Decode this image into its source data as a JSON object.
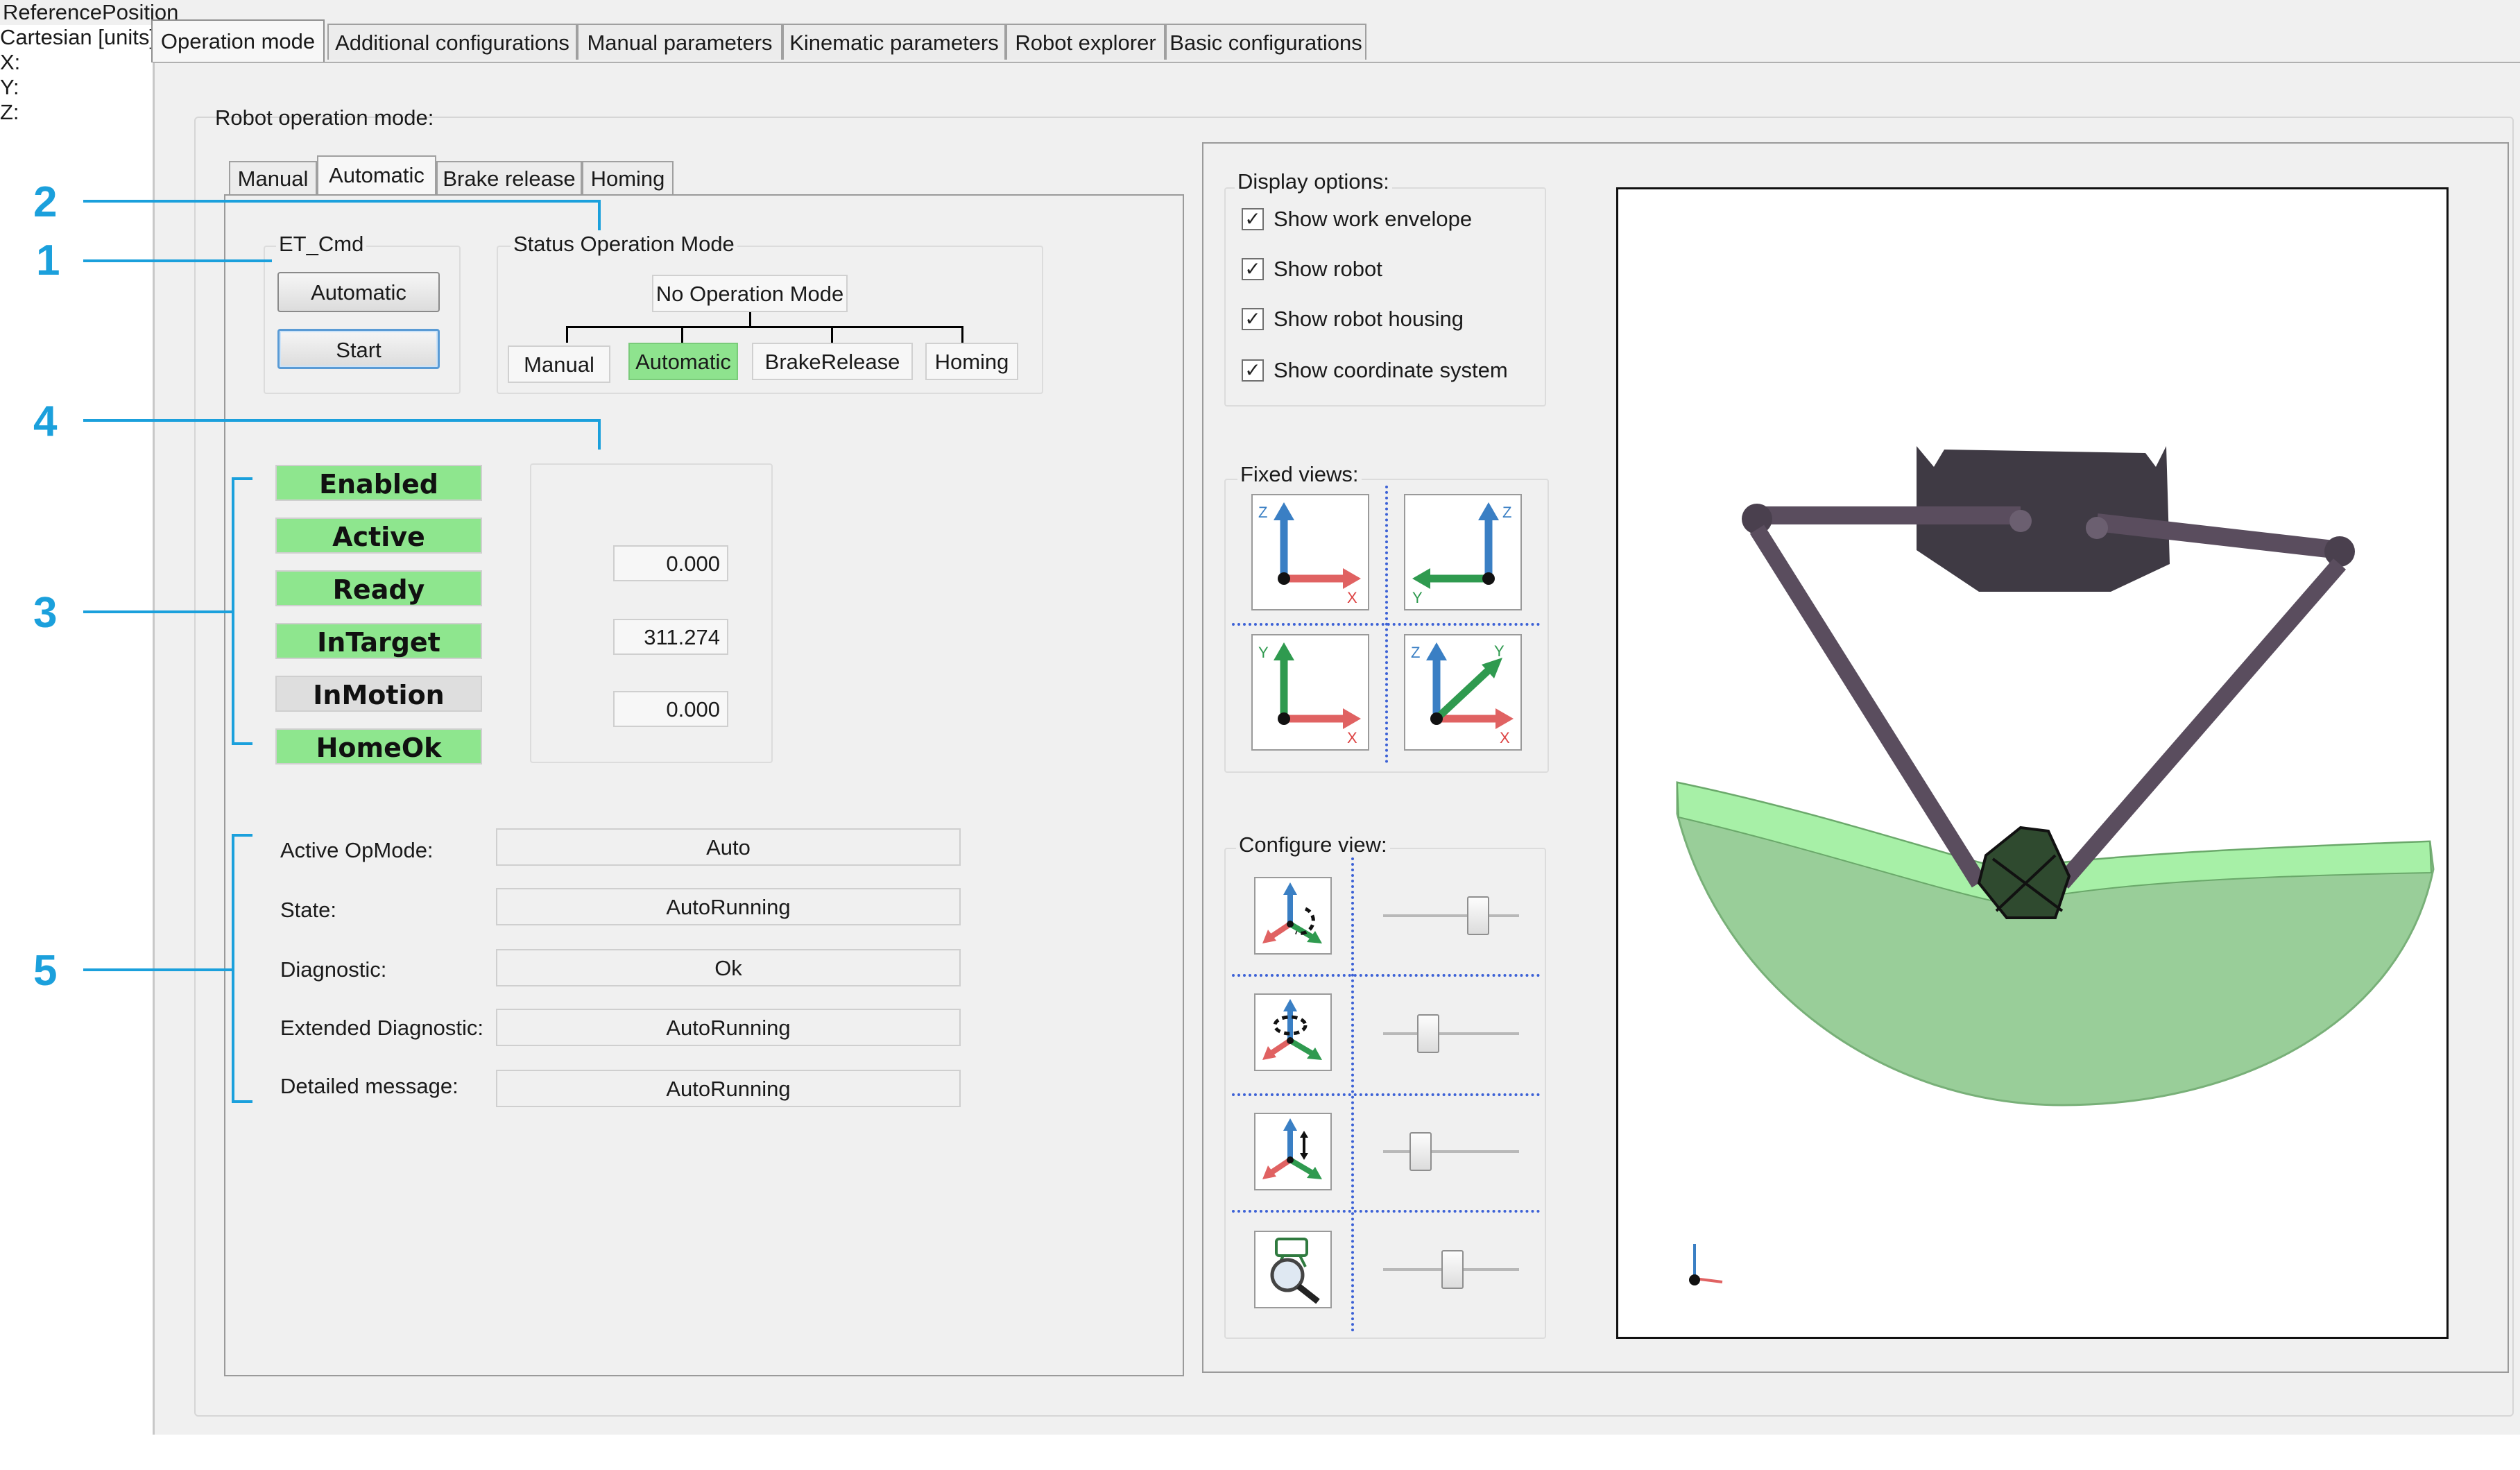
{
  "main_tabs": [
    {
      "label": "Operation mode"
    },
    {
      "label": "Additional configurations"
    },
    {
      "label": "Manual parameters"
    },
    {
      "label": "Kinematic parameters"
    },
    {
      "label": "Robot explorer"
    },
    {
      "label": "Basic configurations"
    }
  ],
  "robot_operation_mode_label": "Robot operation mode:",
  "sub_tabs": [
    {
      "label": "Manual"
    },
    {
      "label": "Automatic"
    },
    {
      "label": "Brake release"
    },
    {
      "label": "Homing"
    }
  ],
  "et_cmd": {
    "title": "ET_Cmd",
    "mode_button": "Automatic",
    "start_button": "Start"
  },
  "status_operation_mode": {
    "title": "Status Operation Mode",
    "root": "No Operation Mode",
    "children": [
      {
        "label": "Manual",
        "active": false
      },
      {
        "label": "Automatic",
        "active": true
      },
      {
        "label": "BrakeRelease",
        "active": false
      },
      {
        "label": "Homing",
        "active": false
      }
    ],
    "active_color": "#8ee38e"
  },
  "indicators": [
    {
      "label": "Enabled",
      "on": true
    },
    {
      "label": "Active",
      "on": true
    },
    {
      "label": "Ready",
      "on": true
    },
    {
      "label": "InTarget",
      "on": true
    },
    {
      "label": "InMotion",
      "on": false
    },
    {
      "label": "HomeOk",
      "on": true
    }
  ],
  "reference_position": {
    "title_line1": "ReferencePosition",
    "title_line2": "Cartesian [units]:",
    "x_label": "X:",
    "x_value": "0.000",
    "y_label": "Y:",
    "y_value": "311.274",
    "z_label": "Z:",
    "z_value": "0.000"
  },
  "info_fields": [
    {
      "label": "Active OpMode:",
      "value": "Auto"
    },
    {
      "label": "State:",
      "value": "AutoRunning"
    },
    {
      "label": "Diagnostic:",
      "value": "Ok"
    },
    {
      "label": "Extended Diagnostic:",
      "value": "AutoRunning"
    },
    {
      "label": "Detailed message:",
      "value": "AutoRunning"
    }
  ],
  "display_options": {
    "title": "Display options:",
    "items": [
      {
        "label": "Show work envelope",
        "checked": true
      },
      {
        "label": "Show robot",
        "checked": true
      },
      {
        "label": "Show robot housing",
        "checked": true
      },
      {
        "label": "Show coordinate system",
        "checked": true
      }
    ]
  },
  "fixed_views": {
    "title": "Fixed views:",
    "buttons": [
      {
        "icon": "xz-view-icon",
        "axes": [
          "Z",
          "X"
        ]
      },
      {
        "icon": "yz-view-icon",
        "axes": [
          "Z",
          "Y"
        ]
      },
      {
        "icon": "xy-view-icon",
        "axes": [
          "Y",
          "X"
        ]
      },
      {
        "icon": "isometric-view-icon",
        "axes": [
          "Z",
          "Y",
          "X"
        ]
      }
    ]
  },
  "configure_view": {
    "title": "Configure view:",
    "rows": [
      {
        "icon": "rotate-z-icon",
        "slider_level": 0.74
      },
      {
        "icon": "rotate-x-icon",
        "slider_level": 0.3
      },
      {
        "icon": "translate-icon",
        "slider_level": 0.23
      },
      {
        "icon": "zoom-icon",
        "slider_level": 0.51
      }
    ]
  },
  "callouts": [
    {
      "num": "1"
    },
    {
      "num": "2"
    },
    {
      "num": "3"
    },
    {
      "num": "4"
    },
    {
      "num": "5"
    }
  ],
  "colors": {
    "callout_blue": "#1ba0dc",
    "indicator_on": "#8ee68e",
    "indicator_off": "#dedede",
    "envelope_green": "#8fd38f",
    "robot_dark": "#3f3a44"
  }
}
